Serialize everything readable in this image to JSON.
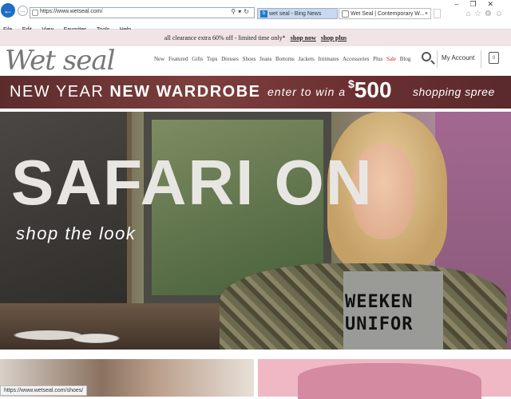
{
  "browser": {
    "url": "https://www.wetseal.com/",
    "tabs": [
      {
        "label": "wet seal - Bing News",
        "icon": "b"
      },
      {
        "label": "Wet Seal | Contemporary W...",
        "close": "×"
      }
    ],
    "menu": [
      "File",
      "Edit",
      "View",
      "Favorites",
      "Tools",
      "Help"
    ],
    "status_url": "https://www.wetseal.com/shoes/"
  },
  "promo": {
    "text": "all clearance extra 60% off - limited time only*",
    "link1": "shop now",
    "link2": "shop plus"
  },
  "header": {
    "logo": "Wet seal",
    "nav": [
      "New",
      "Featured",
      "Gifts",
      "Tops",
      "Dresses",
      "Shoes",
      "Jeans",
      "Bottoms",
      "Jackets",
      "Intimates",
      "Accessories",
      "Plus",
      "Sale",
      "Blog"
    ],
    "account_label": "My Account",
    "bag_count": "0"
  },
  "banner": {
    "part1": "NEW YEAR ",
    "part1_bold": "NEW WARDROBE",
    "part2": "enter to win a",
    "currency": "$",
    "amount": "500",
    "part3": "shopping spree"
  },
  "hero": {
    "headline": "SAFARI ON",
    "subhead": "shop the look",
    "shirt_text": "WEEKEN\nUNIFOR"
  }
}
